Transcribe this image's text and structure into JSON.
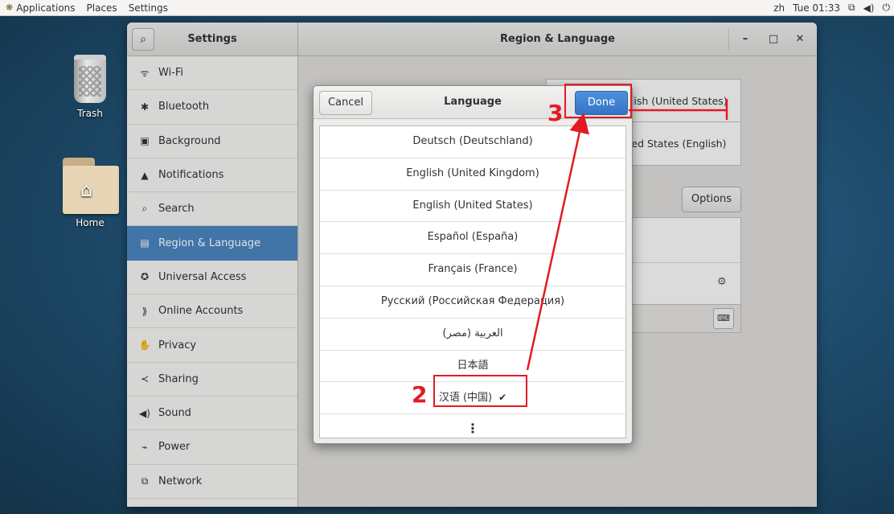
{
  "topbar": {
    "applications": "Applications",
    "places": "Places",
    "settings": "Settings",
    "input_method": "zh",
    "clock": "Tue 01:33"
  },
  "desktop": {
    "trash_label": "Trash",
    "home_label": "Home"
  },
  "window": {
    "sidebar_title": "Settings",
    "panel_title": "Region & Language",
    "minimize": "–",
    "maximize": "□",
    "close": "✕"
  },
  "sidebar": {
    "items": [
      {
        "label": "Wi-Fi",
        "icon": "wifi-icon",
        "glyph": "ᯤ"
      },
      {
        "label": "Bluetooth",
        "icon": "bluetooth-icon",
        "glyph": "✱"
      },
      {
        "label": "Background",
        "icon": "background-icon",
        "glyph": "▣"
      },
      {
        "label": "Notifications",
        "icon": "bell-icon",
        "glyph": "▲"
      },
      {
        "label": "Search",
        "icon": "search-icon",
        "glyph": "⌕"
      },
      {
        "label": "Region & Language",
        "icon": "region-icon",
        "glyph": "▤",
        "active": true
      },
      {
        "label": "Universal Access",
        "icon": "accessibility-icon",
        "glyph": "✪"
      },
      {
        "label": "Online Accounts",
        "icon": "online-accounts-icon",
        "glyph": "⟫"
      },
      {
        "label": "Privacy",
        "icon": "privacy-hand-icon",
        "glyph": "✋"
      },
      {
        "label": "Sharing",
        "icon": "share-icon",
        "glyph": "≺"
      },
      {
        "label": "Sound",
        "icon": "speaker-icon",
        "glyph": "◀)"
      },
      {
        "label": "Power",
        "icon": "power-icon",
        "glyph": "⌁"
      },
      {
        "label": "Network",
        "icon": "network-icon",
        "glyph": "⧉"
      }
    ]
  },
  "content": {
    "language_value_partial": "glish (United States)",
    "formats_value_partial": "ited States (English)",
    "options_label": "Options"
  },
  "dialog": {
    "title": "Language",
    "cancel_label": "Cancel",
    "done_label": "Done",
    "languages": [
      "Deutsch (Deutschland)",
      "English (United Kingdom)",
      "English (United States)",
      "Español (España)",
      "Français (France)",
      "Русский (Российская Федерация)",
      "العربية (مصر)",
      "日本語",
      "汉语 (中国)"
    ],
    "selected_check": "✔",
    "more_label": "⋮"
  },
  "annotations": {
    "step2": "2",
    "step3": "3",
    "color": "#e21b23"
  }
}
